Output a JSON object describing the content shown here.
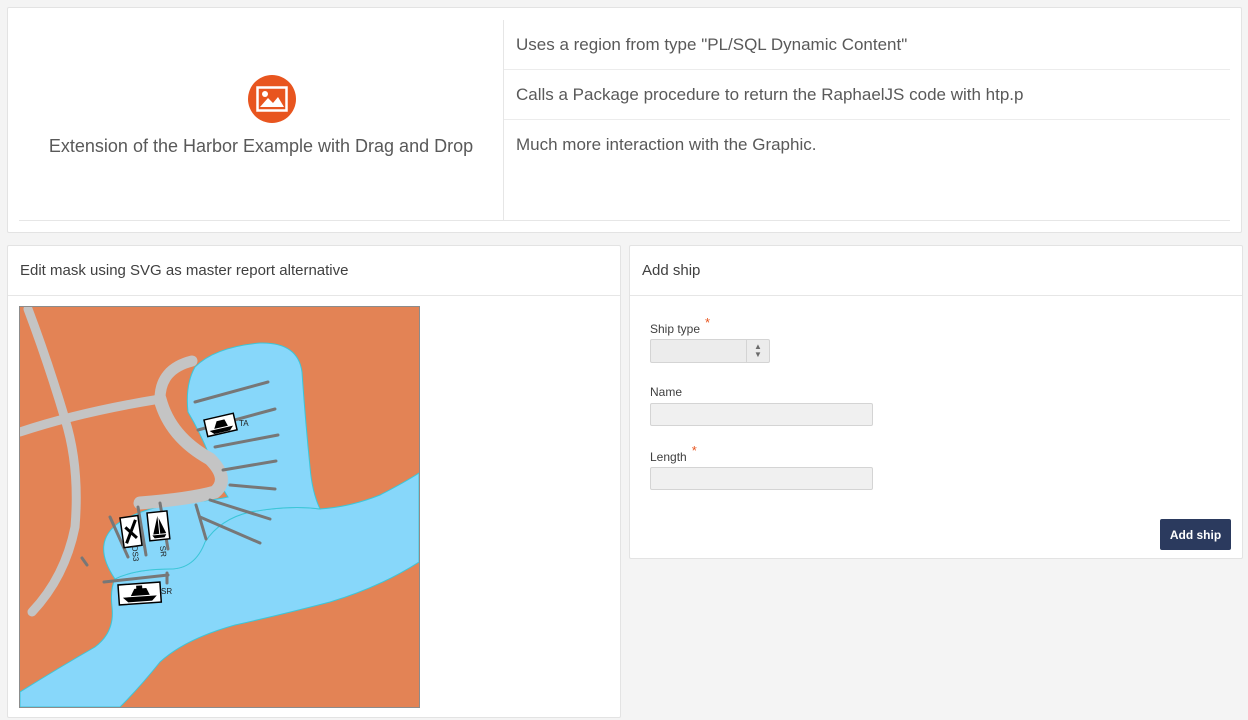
{
  "hero": {
    "title": "Extension of the Harbor Example with Drag and Drop",
    "icon": "image-icon",
    "icon_color": "#e8551f",
    "items": [
      "Uses a region from type \"PL/SQL Dynamic Content\"",
      "Calls a Package procedure to return the RaphaelJS code with htp.p",
      "Much more interaction with the Graphic."
    ]
  },
  "map_region": {
    "title": "Edit mask using SVG as master report alternative",
    "colors": {
      "land": "#e38355",
      "water": "#87d7fa",
      "road": "#c4c4c4",
      "pier": "#777777"
    },
    "labels": [
      "TA",
      "DS3",
      "SR",
      "SR"
    ]
  },
  "add_ship": {
    "title": "Add ship",
    "fields": {
      "ship_type": {
        "label": "Ship type",
        "required_mark": "*",
        "value": ""
      },
      "name": {
        "label": "Name",
        "value": ""
      },
      "length": {
        "label": "Length",
        "required_mark": "*",
        "value": ""
      }
    },
    "submit_label": "Add ship",
    "accent": "#2b3a5e"
  }
}
